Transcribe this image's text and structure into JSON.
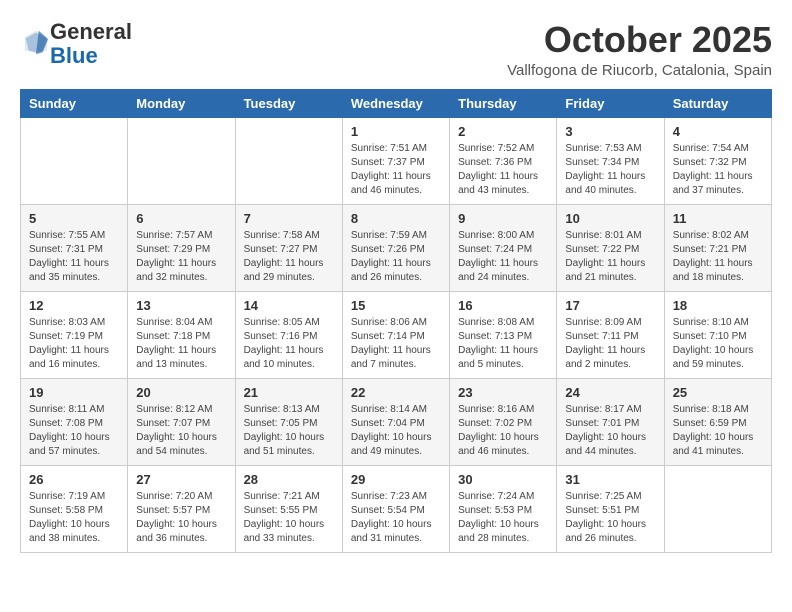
{
  "header": {
    "logo_general": "General",
    "logo_blue": "Blue",
    "month_title": "October 2025",
    "location": "Vallfogona de Riucorb, Catalonia, Spain"
  },
  "weekdays": [
    "Sunday",
    "Monday",
    "Tuesday",
    "Wednesday",
    "Thursday",
    "Friday",
    "Saturday"
  ],
  "weeks": [
    [
      {
        "day": null
      },
      {
        "day": null
      },
      {
        "day": null
      },
      {
        "day": "1",
        "sunrise": "7:51 AM",
        "sunset": "7:37 PM",
        "daylight": "11 hours and 46 minutes."
      },
      {
        "day": "2",
        "sunrise": "7:52 AM",
        "sunset": "7:36 PM",
        "daylight": "11 hours and 43 minutes."
      },
      {
        "day": "3",
        "sunrise": "7:53 AM",
        "sunset": "7:34 PM",
        "daylight": "11 hours and 40 minutes."
      },
      {
        "day": "4",
        "sunrise": "7:54 AM",
        "sunset": "7:32 PM",
        "daylight": "11 hours and 37 minutes."
      }
    ],
    [
      {
        "day": "5",
        "sunrise": "7:55 AM",
        "sunset": "7:31 PM",
        "daylight": "11 hours and 35 minutes."
      },
      {
        "day": "6",
        "sunrise": "7:57 AM",
        "sunset": "7:29 PM",
        "daylight": "11 hours and 32 minutes."
      },
      {
        "day": "7",
        "sunrise": "7:58 AM",
        "sunset": "7:27 PM",
        "daylight": "11 hours and 29 minutes."
      },
      {
        "day": "8",
        "sunrise": "7:59 AM",
        "sunset": "7:26 PM",
        "daylight": "11 hours and 26 minutes."
      },
      {
        "day": "9",
        "sunrise": "8:00 AM",
        "sunset": "7:24 PM",
        "daylight": "11 hours and 24 minutes."
      },
      {
        "day": "10",
        "sunrise": "8:01 AM",
        "sunset": "7:22 PM",
        "daylight": "11 hours and 21 minutes."
      },
      {
        "day": "11",
        "sunrise": "8:02 AM",
        "sunset": "7:21 PM",
        "daylight": "11 hours and 18 minutes."
      }
    ],
    [
      {
        "day": "12",
        "sunrise": "8:03 AM",
        "sunset": "7:19 PM",
        "daylight": "11 hours and 16 minutes."
      },
      {
        "day": "13",
        "sunrise": "8:04 AM",
        "sunset": "7:18 PM",
        "daylight": "11 hours and 13 minutes."
      },
      {
        "day": "14",
        "sunrise": "8:05 AM",
        "sunset": "7:16 PM",
        "daylight": "11 hours and 10 minutes."
      },
      {
        "day": "15",
        "sunrise": "8:06 AM",
        "sunset": "7:14 PM",
        "daylight": "11 hours and 7 minutes."
      },
      {
        "day": "16",
        "sunrise": "8:08 AM",
        "sunset": "7:13 PM",
        "daylight": "11 hours and 5 minutes."
      },
      {
        "day": "17",
        "sunrise": "8:09 AM",
        "sunset": "7:11 PM",
        "daylight": "11 hours and 2 minutes."
      },
      {
        "day": "18",
        "sunrise": "8:10 AM",
        "sunset": "7:10 PM",
        "daylight": "10 hours and 59 minutes."
      }
    ],
    [
      {
        "day": "19",
        "sunrise": "8:11 AM",
        "sunset": "7:08 PM",
        "daylight": "10 hours and 57 minutes."
      },
      {
        "day": "20",
        "sunrise": "8:12 AM",
        "sunset": "7:07 PM",
        "daylight": "10 hours and 54 minutes."
      },
      {
        "day": "21",
        "sunrise": "8:13 AM",
        "sunset": "7:05 PM",
        "daylight": "10 hours and 51 minutes."
      },
      {
        "day": "22",
        "sunrise": "8:14 AM",
        "sunset": "7:04 PM",
        "daylight": "10 hours and 49 minutes."
      },
      {
        "day": "23",
        "sunrise": "8:16 AM",
        "sunset": "7:02 PM",
        "daylight": "10 hours and 46 minutes."
      },
      {
        "day": "24",
        "sunrise": "8:17 AM",
        "sunset": "7:01 PM",
        "daylight": "10 hours and 44 minutes."
      },
      {
        "day": "25",
        "sunrise": "8:18 AM",
        "sunset": "6:59 PM",
        "daylight": "10 hours and 41 minutes."
      }
    ],
    [
      {
        "day": "26",
        "sunrise": "7:19 AM",
        "sunset": "5:58 PM",
        "daylight": "10 hours and 38 minutes."
      },
      {
        "day": "27",
        "sunrise": "7:20 AM",
        "sunset": "5:57 PM",
        "daylight": "10 hours and 36 minutes."
      },
      {
        "day": "28",
        "sunrise": "7:21 AM",
        "sunset": "5:55 PM",
        "daylight": "10 hours and 33 minutes."
      },
      {
        "day": "29",
        "sunrise": "7:23 AM",
        "sunset": "5:54 PM",
        "daylight": "10 hours and 31 minutes."
      },
      {
        "day": "30",
        "sunrise": "7:24 AM",
        "sunset": "5:53 PM",
        "daylight": "10 hours and 28 minutes."
      },
      {
        "day": "31",
        "sunrise": "7:25 AM",
        "sunset": "5:51 PM",
        "daylight": "10 hours and 26 minutes."
      },
      {
        "day": null
      }
    ]
  ],
  "labels": {
    "sunrise_prefix": "Sunrise: ",
    "sunset_prefix": "Sunset: ",
    "daylight_prefix": "Daylight: "
  }
}
